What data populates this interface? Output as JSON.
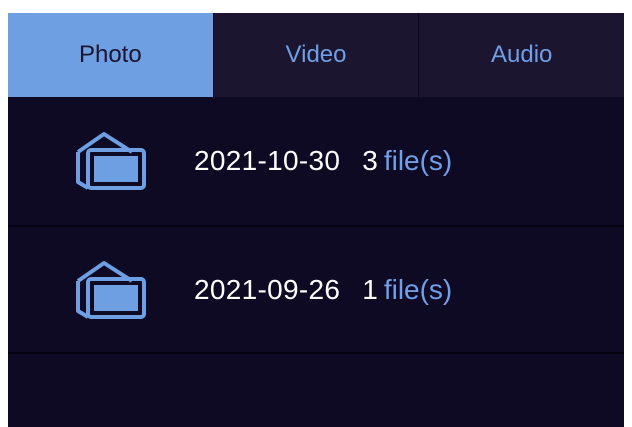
{
  "tabs": [
    {
      "label": "Photo",
      "active": true
    },
    {
      "label": "Video",
      "active": false
    },
    {
      "label": "Audio",
      "active": false
    }
  ],
  "entries": [
    {
      "date": "2021-10-30",
      "count": "3",
      "unit": "file(s)",
      "icon": "photo-stack-icon"
    },
    {
      "date": "2021-09-26",
      "count": "1",
      "unit": "file(s)",
      "icon": "photo-stack-icon"
    }
  ],
  "colors": {
    "background": "#0f0a24",
    "tab_bar": "#1b1530",
    "accent": "#6e9fe3",
    "text": "#ffffff"
  }
}
